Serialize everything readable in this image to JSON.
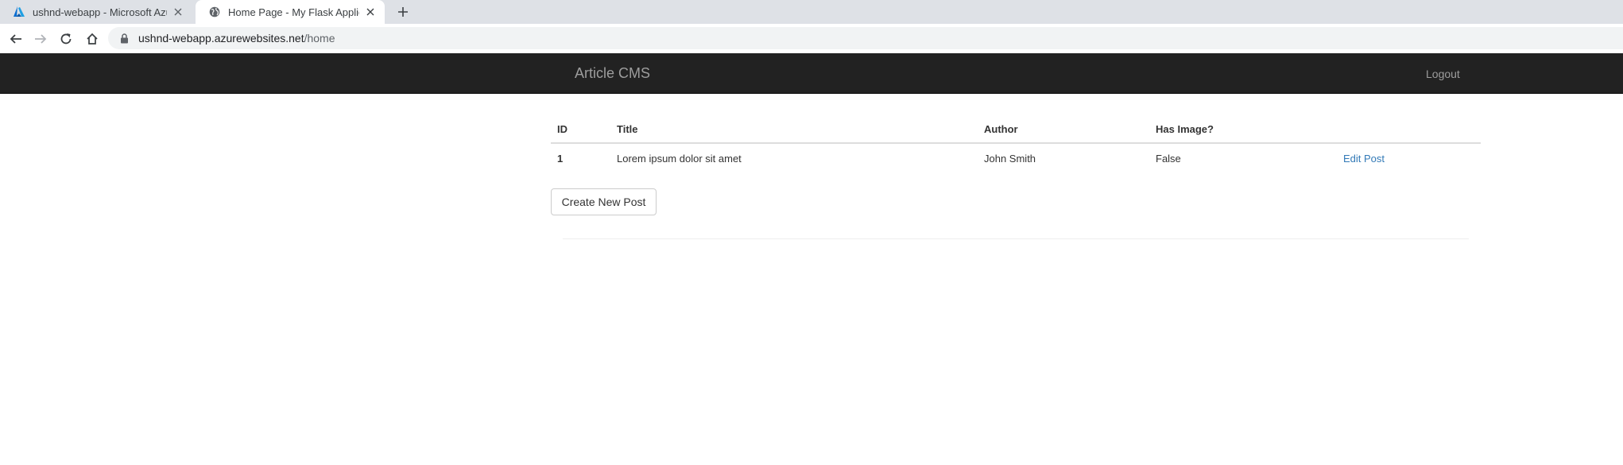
{
  "browser": {
    "tabs": [
      {
        "title": "ushnd-webapp - Microsoft Azure",
        "favicon": "azure-logo-icon",
        "active": false
      },
      {
        "title": "Home Page - My Flask Application",
        "favicon": "globe-icon",
        "active": true
      }
    ],
    "url": {
      "host": "ushnd-webapp.azurewebsites.net",
      "path": "/home"
    }
  },
  "navbar": {
    "brand": "Article CMS",
    "logout_label": "Logout"
  },
  "table": {
    "headers": [
      "ID",
      "Title",
      "Author",
      "Has Image?",
      ""
    ],
    "rows": [
      {
        "id": "1",
        "title": "Lorem ipsum dolor sit amet",
        "author": "John Smith",
        "has_image": "False",
        "action": "Edit Post"
      }
    ]
  },
  "create_button_label": "Create New Post",
  "colors": {
    "navbar_bg": "#222222",
    "navbar_text": "#9d9d9d",
    "link": "#337ab7"
  }
}
